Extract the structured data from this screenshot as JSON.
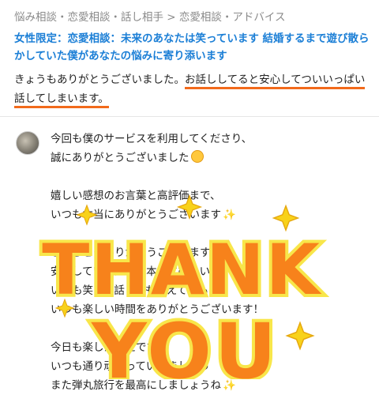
{
  "breadcrumb": "悩み相談・恋愛相談・話し相手 > 恋愛相談・アドバイス",
  "service_title": "女性限定：恋愛相談：未来のあなたは笑っています 結婚するまで遊び散らかしていた僕があなたの悩みに寄り添います",
  "review": {
    "lead": "きょうもありがとうございました。",
    "highlight": "お話ししてると安心してついいっぱい話してしまいます。"
  },
  "reply": {
    "avatar_icon": "user-avatar-photo",
    "lines": [
      "今回も僕のサービスを利用してくださり、",
      "誠にありがとうございました",
      "",
      "嬉しい感想のお言葉と高評価まで、",
      "いつも本当にありがとうございます",
      "",
      "こちらこそありがとうございます！",
      "安心していただけて本当に嬉しいです",
      "いつも笑って話してもらえて僕も",
      "いつも楽しい時間をありがとうございます！",
      "",
      "今日も楽しかったです",
      "いつも通り頑張っていきましょう",
      "また弾丸旅行を最高にしましょうね"
    ]
  },
  "overlay": {
    "line1": "THANK",
    "line2": "YOU",
    "fill_color": "#f7821b",
    "outline_color": "#f8e64a",
    "star_color": "#f8d21a"
  },
  "colors": {
    "link_blue": "#1c7fd6",
    "highlight_orange": "#f26a1b",
    "breadcrumb_gray": "#8a8a8a"
  }
}
